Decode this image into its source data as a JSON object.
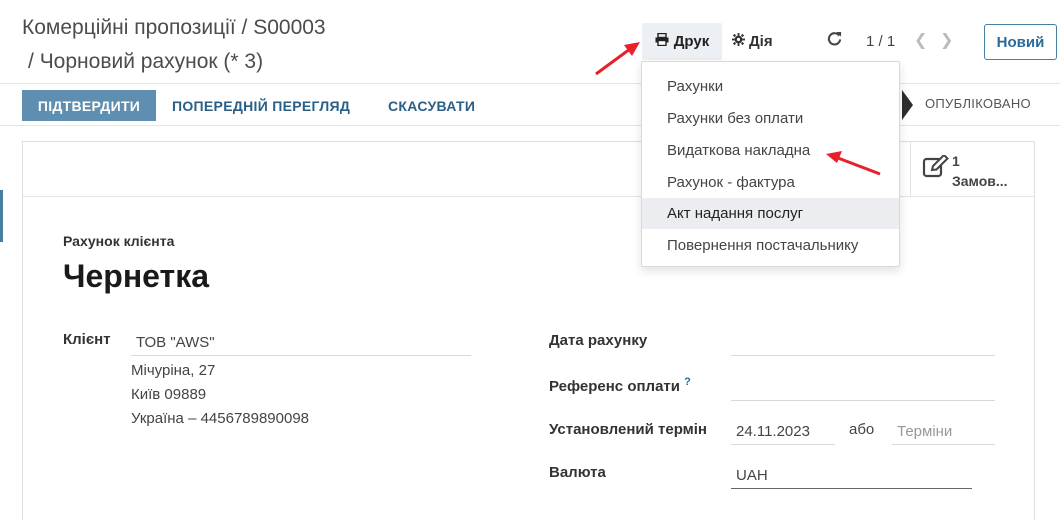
{
  "breadcrumb": {
    "parent": "Комерційні пропозиції",
    "separator": "/",
    "order": "S00003",
    "current": "Чорновий рахунок (* 3)"
  },
  "toolbar": {
    "print_label": "Друк",
    "print_icon": "printer-icon",
    "action_label": "Дія",
    "action_icon": "gear-icon",
    "reload_icon": "refresh-icon",
    "pager": "1 / 1",
    "new_label": "Новий"
  },
  "status_bar": {
    "confirm_label": "ПІДТВЕРДИТИ",
    "preview_label": "ПОПЕРЕДНІЙ ПЕРЕГЛЯД",
    "cancel_label": "СКАСУВАТИ",
    "stage_posted": "ОПУБЛІКОВАНО"
  },
  "print_menu": {
    "items": [
      {
        "label": "Рахунки"
      },
      {
        "label": "Рахунки без оплати"
      },
      {
        "label": "Видаткова накладна"
      },
      {
        "label": "Рахунок - фактура"
      },
      {
        "label": "Акт надання послуг"
      },
      {
        "label": "Повернення постачальнику"
      }
    ]
  },
  "smart_button": {
    "count": "1",
    "label": "Замов...",
    "icon": "edit-icon"
  },
  "form": {
    "doc_type": "Рахунок клієнта",
    "title": "Чернетка",
    "client_label": "Клієнт",
    "client_name": "ТОВ \"AWS\"",
    "client_address": [
      "Мічуріна, 27",
      "Київ 09889",
      "Україна – 4456789890098"
    ],
    "invoice_date_label": "Дата рахунку",
    "payment_ref_label": "Референс оплати",
    "payment_ref_help": "?",
    "due_date_label": "Установлений термін",
    "due_date_value": "24.11.2023",
    "or_label": "або",
    "terms_placeholder": "Терміни",
    "currency_label": "Валюта",
    "currency_value": "UAH"
  },
  "colors": {
    "primary": "#5f8fb0",
    "link": "#2a5f86",
    "annotation_arrow": "#e8202a"
  }
}
